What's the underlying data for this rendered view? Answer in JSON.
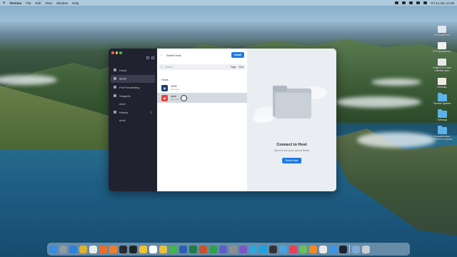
{
  "menubar": {
    "apple": "",
    "app_name": "Termius",
    "items": [
      "File",
      "Edit",
      "View",
      "Window",
      "Help"
    ],
    "clock": "Fri 14 Jan  14:35"
  },
  "sidebar": {
    "items": [
      {
        "label": "Hosts",
        "icon": "hosts-icon",
        "active": false
      },
      {
        "label": "SFTP",
        "icon": "sftp-icon",
        "active": true
      },
      {
        "label": "Port Forwarding",
        "icon": "port-forwarding-icon",
        "active": false
      },
      {
        "label": "Snippets",
        "icon": "snippets-icon",
        "active": false
      },
      {
        "label": "ubuli",
        "icon": "",
        "active": false
      },
      {
        "label": "History",
        "icon": "history-icon",
        "active": false,
        "trail": "search-icon"
      },
      {
        "label": "ubuli",
        "icon": "",
        "active": false
      }
    ]
  },
  "middle": {
    "title": "Select Host",
    "install_label": "Install",
    "search_placeholder": "Search",
    "filter_tags": "Tags",
    "filter_sort": "Sort",
    "section": "Hosts",
    "hosts": [
      {
        "name": "1234",
        "sub": "ssh, root",
        "color": "#1c3d6b"
      },
      {
        "name": "ubuli",
        "sub": "ssh, root",
        "color": "#e4473d"
      }
    ]
  },
  "right": {
    "title": "Connect to Host",
    "subtitle": "Select from your saved Hosts",
    "button": "Select host"
  },
  "desktop": [
    {
      "label": "Изображения",
      "kind": "thumb",
      "color": "#dfe6ee"
    },
    {
      "label": "PDF-документы",
      "kind": "thumb",
      "color": "#f0f0f0"
    },
    {
      "label": "Untitled Pro Max Ultimate spec",
      "kind": "thumb",
      "color": "#e8e8e8"
    },
    {
      "label": "Фильмы",
      "kind": "thumb",
      "color": "#efe9e0"
    },
    {
      "label": "Личные файлы",
      "kind": "folder",
      "color": "#5db3e8"
    },
    {
      "label": "Таблицы",
      "kind": "folder",
      "color": "#5db3e8"
    },
    {
      "label": "Сохраненные объекты стороны",
      "kind": "folder",
      "color": "#5db3e8"
    }
  ],
  "dock": [
    {
      "name": "finder-icon",
      "color": "#3b8de0"
    },
    {
      "name": "launchpad-icon",
      "color": "#8f9aa6"
    },
    {
      "name": "safari-icon",
      "color": "#2e7fd6"
    },
    {
      "name": "chrome-icon",
      "color": "#e0b230"
    },
    {
      "name": "yandex-icon",
      "color": "#eaeaea"
    },
    {
      "name": "brave-icon",
      "color": "#f06a2a"
    },
    {
      "name": "firefox-icon",
      "color": "#ef7e2b"
    },
    {
      "name": "dark-app-icon",
      "color": "#2a2a2e"
    },
    {
      "name": "clock-icon",
      "color": "#222"
    },
    {
      "name": "notes-icon",
      "color": "#f1c232"
    },
    {
      "name": "calendar-icon",
      "color": "#ffffff"
    },
    {
      "name": "photos-icon",
      "color": "#e7c03c"
    },
    {
      "name": "messages-icon",
      "color": "#3fb74d"
    },
    {
      "name": "word-icon",
      "color": "#2b5fb5"
    },
    {
      "name": "excel-icon",
      "color": "#1f7a45"
    },
    {
      "name": "powerpoint-icon",
      "color": "#c9512c"
    },
    {
      "name": "facetime-icon",
      "color": "#30a14e"
    },
    {
      "name": "teams-icon",
      "color": "#5b5fc7"
    },
    {
      "name": "settings-icon",
      "color": "#8e8e93"
    },
    {
      "name": "viber-icon",
      "color": "#7b55c9"
    },
    {
      "name": "telegram-icon",
      "color": "#2ea6dd"
    },
    {
      "name": "skype-icon",
      "color": "#1da1e0"
    },
    {
      "name": "terminal-icon",
      "color": "#333"
    },
    {
      "name": "vpn-icon",
      "color": "#4aa3df"
    },
    {
      "name": "music-icon",
      "color": "#ea3f58"
    },
    {
      "name": "maps-icon",
      "color": "#6bbf59"
    },
    {
      "name": "vlc-icon",
      "color": "#f08a24"
    },
    {
      "name": "preview-icon",
      "color": "#e8e8e8"
    },
    {
      "name": "mail-icon",
      "color": "#3d95e8"
    },
    {
      "name": "termius-icon",
      "color": "#1e2230"
    },
    {
      "name": "downloads-icon",
      "color": "#7fa8d6"
    },
    {
      "name": "trash-icon",
      "color": "#c8ccd2"
    }
  ]
}
